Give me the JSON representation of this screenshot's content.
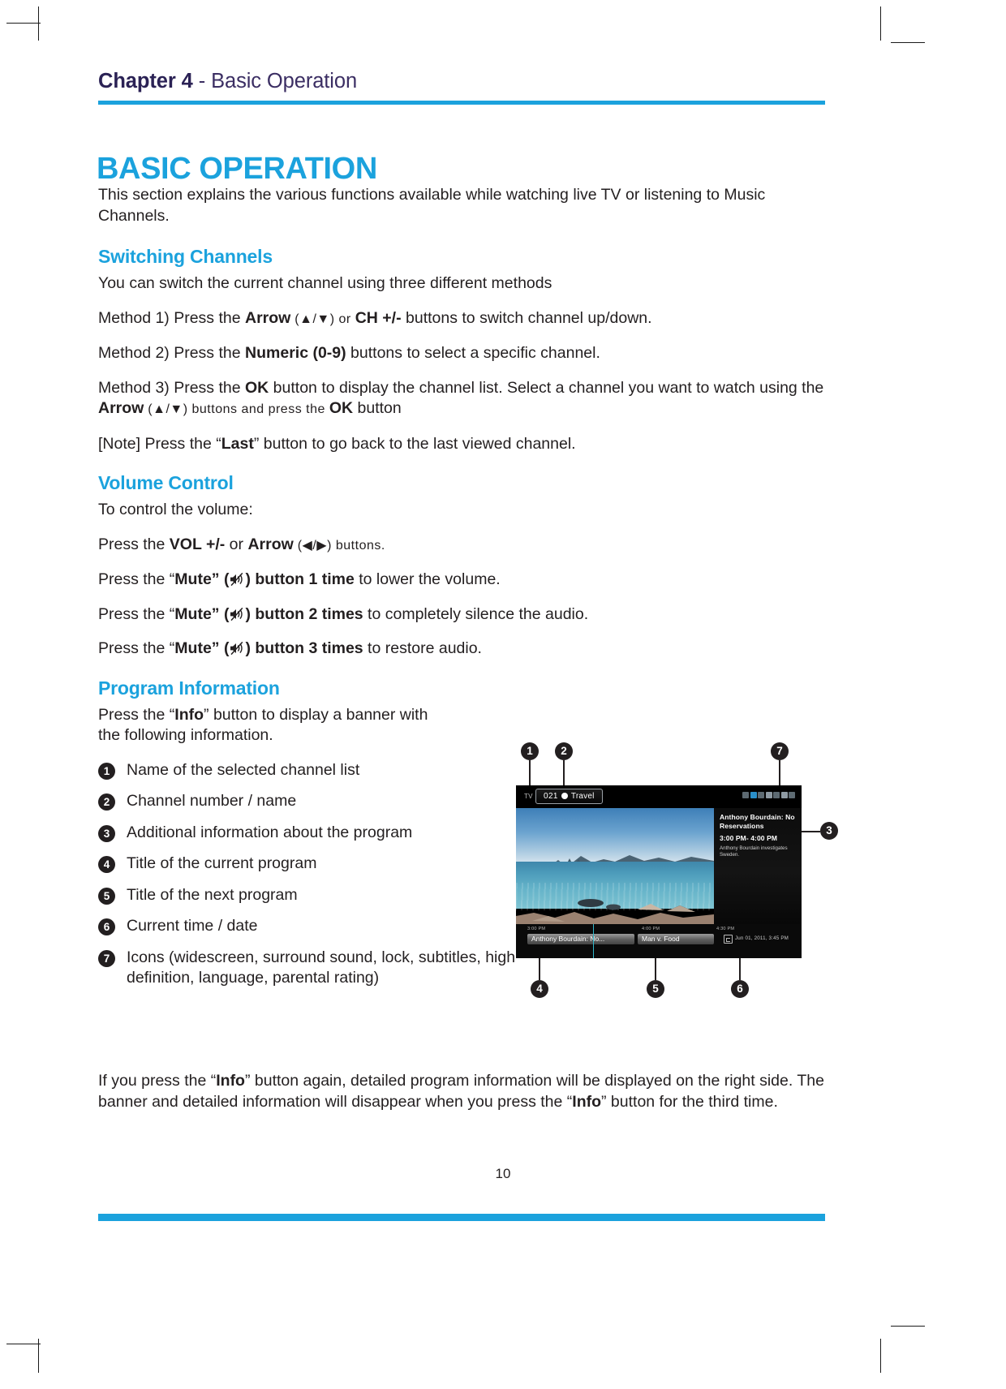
{
  "header": {
    "chapter_label": "Chapter 4",
    "chapter_separator": " - ",
    "chapter_title": "Basic Operation"
  },
  "title": "BASIC OPERATION",
  "intro": {
    "line": "This section explains the various functions available while watching live TV or listening to Music Channels."
  },
  "sections": {
    "switching": {
      "heading": "Switching Channels",
      "lead": "You can switch the current channel using three different methods",
      "method1_a": "Method 1) Press the ",
      "method1_b": "Arrow",
      "method1_c": " (▲/▼) or ",
      "method1_d": "CH +/-",
      "method1_e": " buttons to switch channel up/down.",
      "method2_a": "Method 2) Press the ",
      "method2_b": "Numeric (0-9)",
      "method2_c": " buttons to select a specific channel.",
      "method3_a": "Method 3) Press the ",
      "method3_b": "OK",
      "method3_c": " button to display the channel list. Select a channel you want to watch using the ",
      "method3_d": "Arrow",
      "method3_e": " (▲/▼) buttons and press the ",
      "method3_f": "OK",
      "method3_g": " button",
      "note_a": "[Note] Press the “",
      "note_b": "Last",
      "note_c": "” button to go back to the last viewed channel."
    },
    "volume": {
      "heading": "Volume Control",
      "lead": "To control the volume:",
      "press_a": "Press the ",
      "press_b": "VOL +/-",
      "press_c": " or ",
      "press_d": "Arrow",
      "press_e": " (◀/▶) buttons.",
      "mute_prefix": "Press the “",
      "mute_word": "Mute",
      "mute_mid": "” (",
      "mute_close": ") button ",
      "mute1_count": "1 time",
      "mute1_tail": " to lower the volume.",
      "mute2_count": "2 times",
      "mute2_tail": " to completely silence the audio.",
      "mute3_count": "3 times",
      "mute3_tail": " to restore audio."
    },
    "program": {
      "heading": "Program Information",
      "lead_a": "Press the “",
      "lead_b": "Info",
      "lead_c": "” button to display a banner with the following information.",
      "items": [
        {
          "num": "1",
          "text": "Name of the selected channel list"
        },
        {
          "num": "2",
          "text": "Channel number / name"
        },
        {
          "num": "3",
          "text": "Additional information about the program"
        },
        {
          "num": "4",
          "text": "Title of the current program"
        },
        {
          "num": "5",
          "text": "Title of the next program"
        },
        {
          "num": "6",
          "text": "Current time / date"
        },
        {
          "num": "7",
          "text": "Icons (widescreen, surround sound, lock, subtitles, high definition, language, parental rating)"
        }
      ],
      "closing_a": "If you press the “",
      "closing_b": "Info",
      "closing_c": "” button again, detailed program information will be displayed on the right side. The banner and detailed information will disappear when you press the “",
      "closing_d": "Info",
      "closing_e": "” button for the third time."
    }
  },
  "figure": {
    "tv_source_label": "TV",
    "channel_number": "021",
    "channel_name": "Travel",
    "detail_title": "Anthony Bourdain: No Reservations",
    "detail_time": "3:00 PM- 4:00 PM",
    "detail_desc": "Anthony Bourdain investigates Sweden.",
    "timeline": {
      "time1": "3:00 PM",
      "time2": "4:00 PM",
      "time3": "4:30 PM",
      "now_program": "Anthony Bourdain: No...",
      "next_program": "Man v. Food",
      "datetime": "Jun 01, 2011,  3:45 PM"
    },
    "callouts": [
      "1",
      "2",
      "3",
      "4",
      "5",
      "6",
      "7"
    ]
  },
  "footer": {
    "page_number": "10"
  },
  "colors": {
    "accent": "#1ba2dd",
    "heading_dark": "#2b2255",
    "body": "#231f20"
  }
}
